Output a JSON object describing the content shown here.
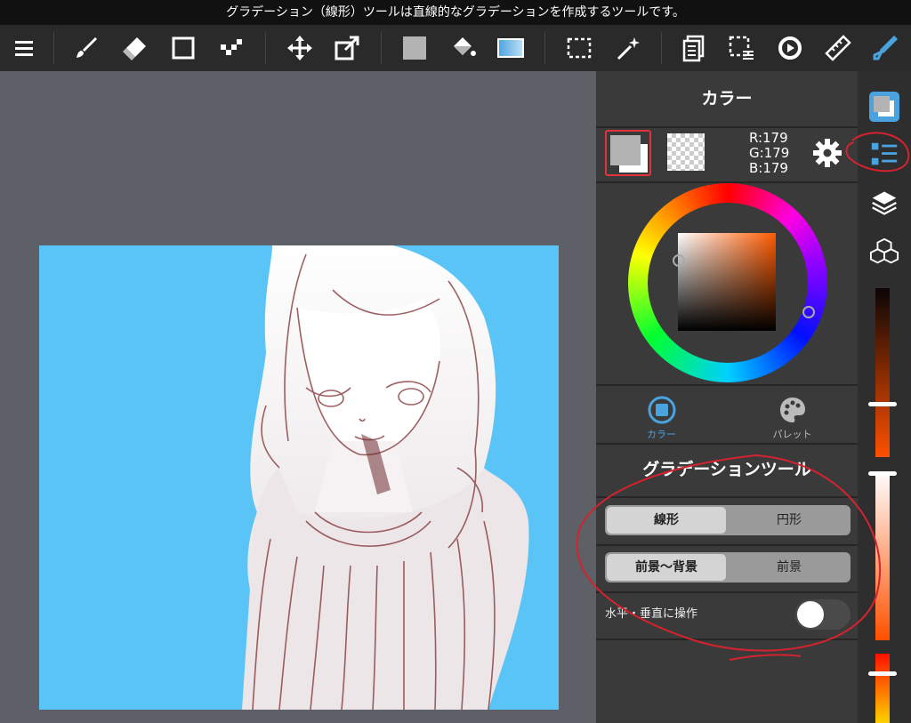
{
  "tooltip": "グラデーション（線形）ツールは直線的なグラデーションを作成するツールです。",
  "toolbar": {
    "tools": [
      "menu-icon",
      "brush-icon",
      "eraser-icon",
      "shape-icon",
      "dot-brush-icon",
      "move-icon",
      "transform-icon",
      "fill-color-icon",
      "bucket-icon",
      "gradient-icon",
      "selection-icon",
      "magic-wand-icon",
      "copy-layer-icon",
      "select-layer-icon",
      "rotate-icon",
      "ruler-icon",
      "pen-icon"
    ]
  },
  "panel": {
    "title": "カラー",
    "rgb": {
      "r": "R:179",
      "g": "G:179",
      "b": "B:179"
    },
    "colors": {
      "foreground": "#b3b3b3",
      "background": "#ffffff",
      "accent": "#4aa3df"
    },
    "tabs": [
      {
        "label": "カラー",
        "active": true
      },
      {
        "label": "パレット",
        "active": false
      }
    ],
    "gradient": {
      "title": "グラデーションツール",
      "shape": {
        "options": [
          "線形",
          "円形"
        ],
        "selected": "線形"
      },
      "mode": {
        "options": [
          "前景〜背景",
          "前景"
        ],
        "selected": "前景〜背景"
      },
      "axis_lock_label": "水平・垂直に操作",
      "axis_lock_on": false
    }
  },
  "right_bar": {
    "buttons": [
      "color-swatch-icon",
      "property-icon",
      "layers-icon",
      "materials-icon"
    ],
    "sliders": [
      {
        "name": "opacity-slider",
        "value": 0.6
      },
      {
        "name": "brush-size-slider",
        "value": 0.05
      },
      {
        "name": "hue-slider",
        "value": 0.1
      }
    ]
  }
}
